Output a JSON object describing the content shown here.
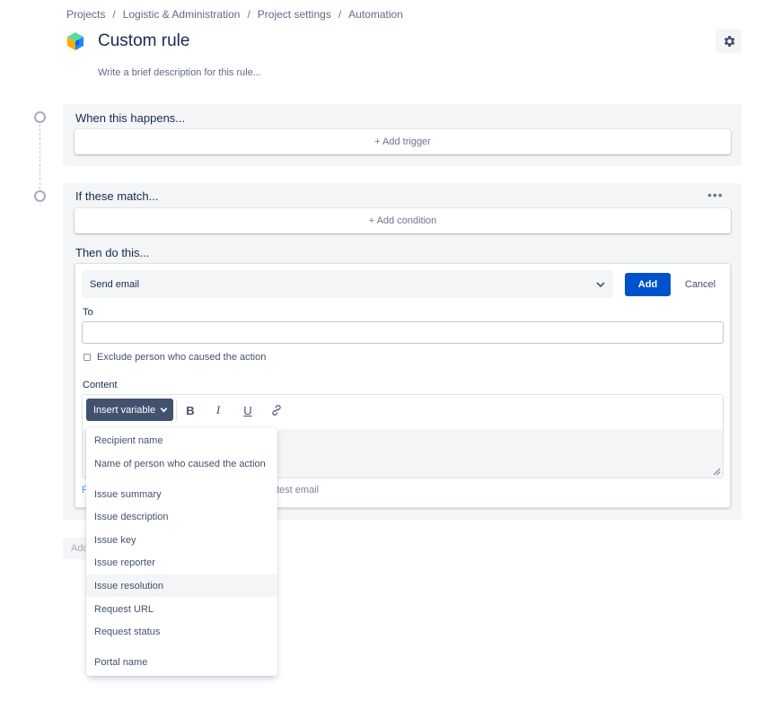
{
  "breadcrumb": {
    "items": [
      "Projects",
      "Logistic & Administration",
      "Project settings",
      "Automation"
    ],
    "separator": "/"
  },
  "header": {
    "title": "Custom rule",
    "description_placeholder": "Write a brief description for this rule...",
    "settings_icon": "gear-icon"
  },
  "trigger": {
    "label": "When this happens...",
    "add_label": "+ Add trigger"
  },
  "condition": {
    "label": "If these match...",
    "add_label": "+ Add condition",
    "more_label": "•••"
  },
  "action": {
    "label": "Then do this...",
    "selected": "Send email",
    "add_button": "Add",
    "cancel_button": "Cancel",
    "to_label": "To",
    "to_value": "",
    "exclude_label": "Exclude person who caused the action",
    "exclude_checked": false,
    "content_label": "Content",
    "insert_variable_label": "Insert variable",
    "toolbar": {
      "bold": "B",
      "italic": "I",
      "underline": "U"
    },
    "footer_left_fragment": "F",
    "footer_send_test_fragment": "test email"
  },
  "below_fragment": "Add",
  "variables_menu": {
    "groups": [
      [
        "Recipient name",
        "Name of person who caused the action"
      ],
      [
        "Issue summary",
        "Issue description",
        "Issue key",
        "Issue reporter",
        "Issue resolution",
        "Request URL",
        "Request status"
      ],
      [
        "Portal name"
      ]
    ],
    "highlighted": "Issue resolution"
  },
  "colors": {
    "primary": "#0052cc",
    "dark_button": "#42526e",
    "panel_bg": "#f4f5f7",
    "text": "#172b4d"
  }
}
